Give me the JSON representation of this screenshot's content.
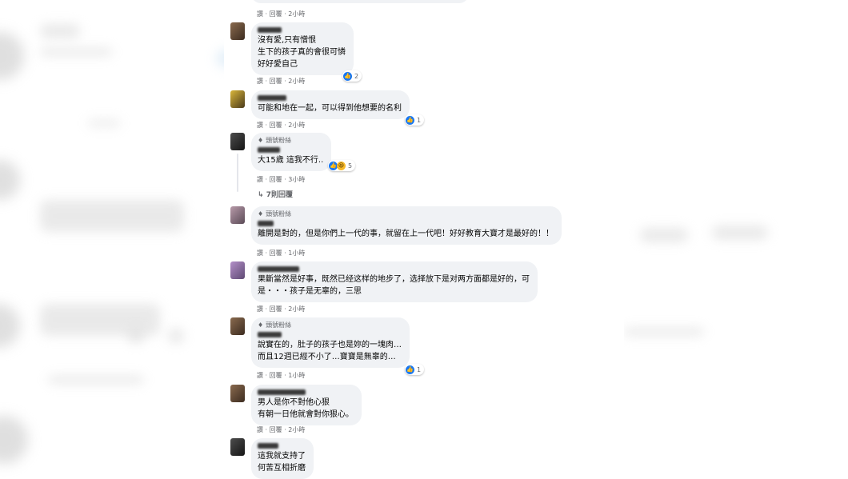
{
  "meta_prefix": "讚 · 回覆 · ",
  "fan_badge": "頭號粉絲",
  "icons": {
    "badge": "diamond-icon",
    "reply": "reply-arrow-icon",
    "like": "like-icon",
    "haha": "haha-icon"
  },
  "colors": {
    "bubble": "#f0f2f5",
    "meta_text": "#65676b",
    "like_blue": "#1877f2"
  },
  "top_comment": {
    "time": "2小時"
  },
  "comments": [
    {
      "lines": [
        "沒有愛,只有憎恨",
        "生下的孩子真的會很可憐",
        "好好愛自己"
      ],
      "time": "2小時",
      "reactions": "2"
    },
    {
      "lines": [
        "可能和地在一起，可以得到他想要的名利"
      ],
      "time": "2小時",
      "reactions": "1"
    },
    {
      "badge": "頭號粉絲",
      "lines": [
        "大15歲 這我不行.."
      ],
      "time": "3小時",
      "reactions": "5",
      "replies": "7則回覆"
    },
    {
      "badge": "頭號粉絲",
      "lines": [
        "離開是對的，但是你們上一代的事，就留在上一代吧！好好教育大寶才是最好的！！"
      ],
      "time": "1小時"
    },
    {
      "lines": [
        "果斷當然是好事，既然已经这样的地步了，选择放下是对两方面都是好的，可",
        "是・・・孩子是无辜的，三思"
      ],
      "time": "2小時"
    },
    {
      "badge": "頭號粉絲",
      "lines": [
        "說實在的，肚子的孩子也是妳的一塊肉…",
        "而且12週已經不小了…寶寶是無辜的…"
      ],
      "time": "1小時",
      "reactions": "1"
    },
    {
      "lines": [
        "男人是你不對他心狠",
        "有朝一日他就會對你狠心。"
      ],
      "time": "2小時"
    },
    {
      "lines": [
        "這我就支持了",
        "何苦互相折磨"
      ]
    }
  ]
}
